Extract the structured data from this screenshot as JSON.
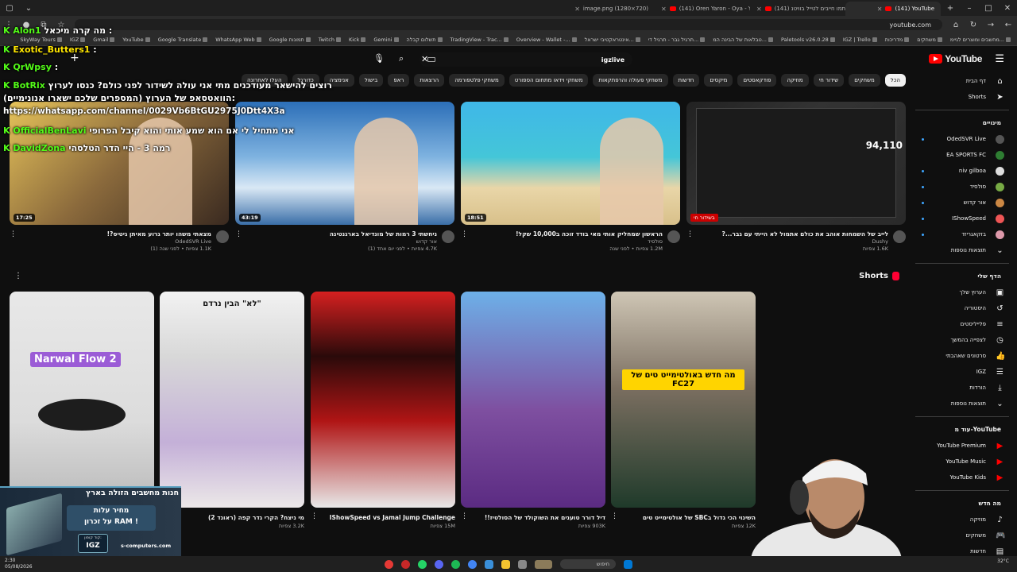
{
  "browser": {
    "tabs": [
      {
        "label": "(141) YouTube",
        "active": true
      },
      {
        "label": "(141) אתמו חייבים לטייל בוויטנ...",
        "active": false
      },
      {
        "label": "(141) Oren Yaron - Oya - YouTu...",
        "active": false
      },
      {
        "label": "image.png (1280×720)",
        "active": false
      }
    ],
    "url": "youtube.com",
    "bookmarks": [
      "SkyWay Tours",
      "IGZ",
      "Gmail",
      "YouTube",
      "Google Translate",
      "WhatsApp Web",
      "Google תמונות",
      "Twitch",
      "Kick",
      "Gemini",
      "תשלום קבלה",
      "TradingView - Trac...",
      "Overview - Wallet -...",
      "אינטראקטיבי ישראל...",
      "תרגיל גבר - תרגיל די...",
      "טבלאות של הבינה המ...",
      "Paletools v26.0.28",
      "IGZ | Trello",
      "מדריכות",
      "משחקים",
      "מחשבים ומוצרים לגיימ..."
    ]
  },
  "masthead": {
    "logo_text": "YouTube",
    "search_value": "igzlive"
  },
  "chips": [
    "הכל",
    "משחקים",
    "שידור חי",
    "מוזיקה",
    "פודקאסטים",
    "מיקסים",
    "חדשות",
    "משחקי פעולה והרפתקאות",
    "משחקי וידאו מתחום הספורט",
    "משחקי פלטפורמה",
    "הרצאות",
    "ראפ",
    "בישול",
    "אנימציה",
    "כדורגל",
    "העלו לאחרונה",
    "נצפה",
    "חדש בשבילך"
  ],
  "sidebar": {
    "main": [
      {
        "label": "דף הבית",
        "icon": "home-icon"
      },
      {
        "label": "Shorts",
        "icon": "shorts-icon"
      }
    ],
    "subscriptions_title": "מינויים",
    "subscriptions": [
      {
        "label": "OdedSVR Live",
        "live": true
      },
      {
        "label": "EA SPORTS FC",
        "live": false
      },
      {
        "label": "niv gilboa",
        "live": true
      },
      {
        "label": "סולסיד",
        "live": true
      },
      {
        "label": "אור קדוש",
        "live": true
      },
      {
        "label": "IShowSpeed",
        "live": true
      },
      {
        "label": "בזקאגריזד",
        "live": true
      },
      {
        "label": "תוצאות נוספות",
        "live": false
      }
    ],
    "you_title": "הדף שלי",
    "you": [
      {
        "label": "הערוץ שלך",
        "icon": "channel-icon"
      },
      {
        "label": "היסטוריה",
        "icon": "history-icon"
      },
      {
        "label": "פלייליסטים",
        "icon": "playlist-icon"
      },
      {
        "label": "לצפייה בהמשך",
        "icon": "clock-icon"
      },
      {
        "label": "סרטונים שאהבתי",
        "icon": "like-icon"
      },
      {
        "label": "IGZ",
        "icon": "list-icon"
      },
      {
        "label": "הורדות",
        "icon": "download-icon"
      },
      {
        "label": "תוצאות נוספות",
        "icon": "chevron-down-icon"
      }
    ],
    "more_title": "עוד מ-YouTube",
    "more": [
      {
        "label": "YouTube Premium"
      },
      {
        "label": "YouTube Music"
      },
      {
        "label": "YouTube Kids"
      }
    ],
    "explore_title": "מה חדש",
    "explore": [
      {
        "label": "מוזיקה",
        "icon": "music-icon"
      },
      {
        "label": "משחקים",
        "icon": "game-icon"
      },
      {
        "label": "חדשות",
        "icon": "news-icon"
      }
    ]
  },
  "videos": [
    {
      "title": "לייב של השמחות אוהב את כולם אתמול לא הייתי עם גבר...?",
      "channel": "Dushy",
      "stats": "1.6K צפיות",
      "duration": "",
      "overlay": "94,110",
      "badge": "בשידור חי"
    },
    {
      "title": "הראשון שמחליק אותי מאי בודד זוכה ב10,000 שקל!",
      "channel": "סולסיד",
      "stats": "1.2M צפיות • לפני שנה",
      "duration": "18:51",
      "overlay": "",
      "badge": ""
    },
    {
      "title": "ניחשתי 3 רמות של מונדיאל בארגנטינה",
      "channel": "אור קדוש",
      "stats": "4.7K צפיות • לפני יום אחד (1)",
      "duration": "43:19",
      "overlay": "",
      "badge": ""
    },
    {
      "title": "מצאתי משהו יותר גרוע מאיתן גיטיס?!",
      "channel": "OdedSVR Live",
      "stats": "1.1K צפיות • לפני שנה (1)",
      "duration": "17:25",
      "overlay": "",
      "badge": ""
    }
  ],
  "shorts": {
    "title": "Shorts",
    "items": [
      {
        "title": "השינוי הכי גדול בSBC של אולטימייט טים",
        "views": "12K צפיות",
        "caption": "מה חדש באולטימייט טים של FC27"
      },
      {
        "title": "דיל דורר טוענים את השוקולד של הסולטיז!!",
        "views": "903K צפיות",
        "caption": ""
      },
      {
        "title": "IShowSpeed vs Jamal Jump Challenge",
        "views": "15M צפיות",
        "caption": ""
      },
      {
        "title": "מי ניצח? הקרי גדר קפה (ראונד 2)",
        "views": "3.2K צפיות",
        "caption": "\"לא\" הבין נרדם"
      },
      {
        "title": "Narwal Flow 2",
        "views": "",
        "caption": "Narwal Flow 2"
      }
    ]
  },
  "overlay_chat": [
    {
      "user": "Alon1",
      "text": "מה קרה מיכאל :"
    },
    {
      "user": "Exotic_Butters1",
      "text": ":"
    },
    {
      "user": "QrWpsy",
      "text": ":"
    },
    {
      "user": "BotRix",
      "text": "רוצים להישאר מעודכנים מתי אני עולה לשידור לפני כולם? כנסו לערוץ הוואטסאפ של הערוץ (המספרים שלכם ישארו אנונימיים):"
    },
    {
      "user": "",
      "text": "https://whatsapp.com/channel/0029Vb6BtGU2975J0Dtt4X3a"
    },
    {
      "user": "OfficialBenLavi",
      "text": "אני מתחיל לי אם הוא שמע אותי והוא קיבל הפרופי"
    },
    {
      "user": "DavidZona",
      "text": "רמה 3 - היי הדר הטלסהי"
    }
  ],
  "promo": {
    "headline": "חנות מחשבים הזולה בארץ",
    "line1": "מחיר עלות",
    "line2": "על זכרון RAM !",
    "code_label": "קוד קופון:",
    "code": "IGZ",
    "site": "s-computers.com"
  },
  "taskbar": {
    "search_placeholder": "חיפוש",
    "time": "2:30",
    "date": "05/08/2026",
    "weather": "32°C"
  },
  "colors": {
    "youtube_red": "#ff0000",
    "kick_green": "#53fc18",
    "live_red": "#cc0000",
    "background": "#0f0f0f"
  }
}
